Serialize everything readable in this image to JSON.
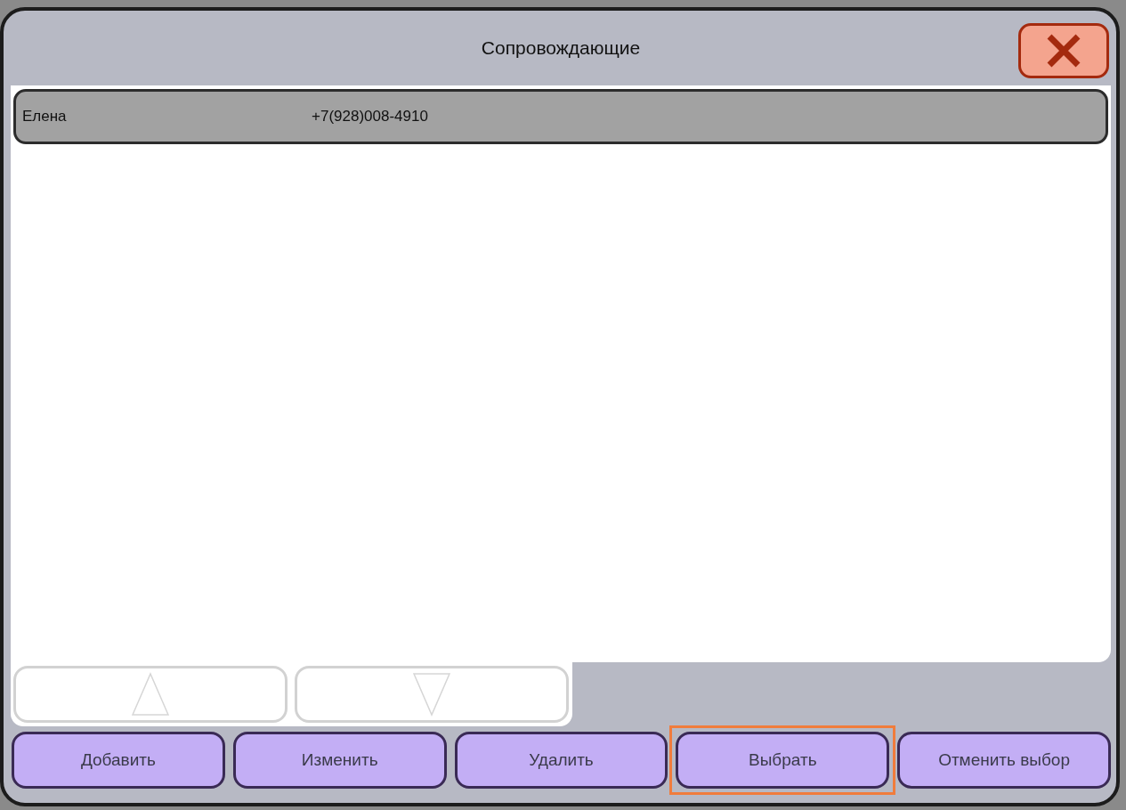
{
  "dialog": {
    "title": "Сопровождающие"
  },
  "rows": [
    {
      "name": "Елена",
      "phone": "+7(928)008-4910",
      "selected": true
    }
  ],
  "scroll_buttons": [
    {
      "kind": "up",
      "disabled": true
    },
    {
      "kind": "down",
      "disabled": true
    }
  ],
  "buttons": [
    {
      "label": "Добавить",
      "focused": false
    },
    {
      "label": "Изменить",
      "focused": false
    },
    {
      "label": "Удалить",
      "focused": false
    },
    {
      "label": "Выбрать",
      "focused": true
    },
    {
      "label": "Отменить выбор",
      "focused": false
    }
  ]
}
